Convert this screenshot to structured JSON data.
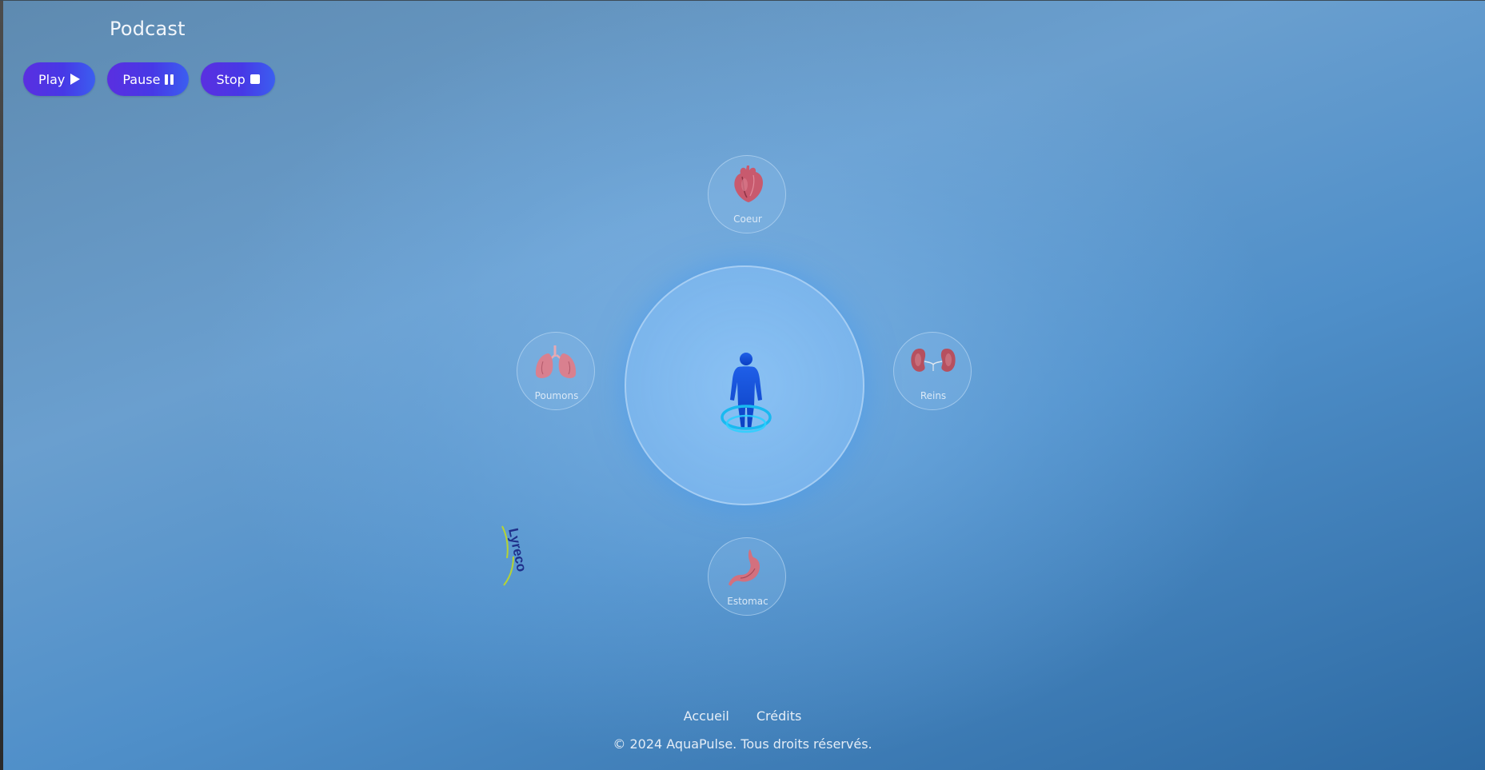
{
  "header": {
    "title": "Podcast"
  },
  "controls": {
    "play_label": "Play",
    "pause_label": "Pause",
    "stop_label": "Stop",
    "play_icon": "play-icon",
    "pause_icon": "pause-icon",
    "stop_icon": "stop-icon"
  },
  "organs": {
    "heart": {
      "label": "Coeur",
      "icon": "heart-icon"
    },
    "lungs": {
      "label": "Poumons",
      "icon": "lungs-icon"
    },
    "kidneys": {
      "label": "Reins",
      "icon": "kidneys-icon"
    },
    "stomach": {
      "label": "Estomac",
      "icon": "stomach-icon"
    }
  },
  "center": {
    "icon": "human-figure-icon"
  },
  "logo": {
    "text": "Lyreco",
    "icon": "lyreco-logo"
  },
  "footer": {
    "links": [
      "Accueil",
      "Crédits"
    ],
    "copyright": "© 2024 AquaPulse. Tous droits réservés."
  },
  "colors": {
    "button_gradient_start": "#5a2fe0",
    "button_gradient_end": "#3b5ef0",
    "background_accent": "#4f8fc9"
  }
}
